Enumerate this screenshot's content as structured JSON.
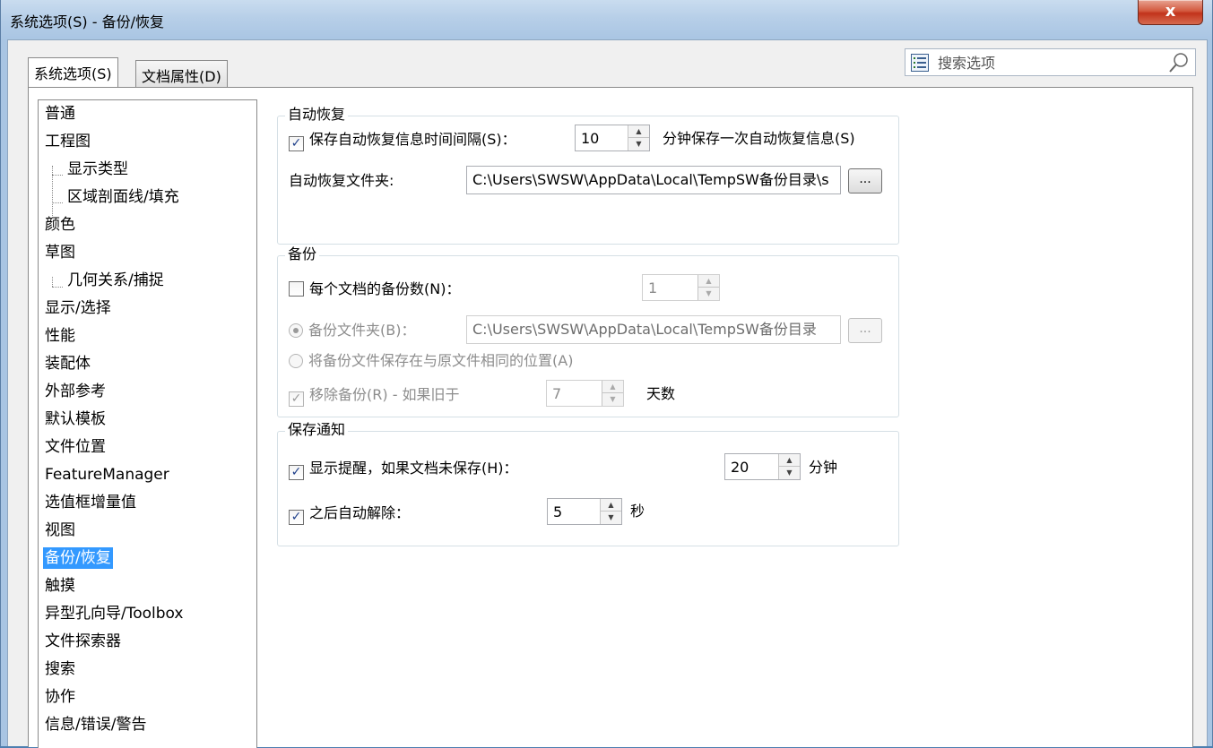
{
  "window": {
    "title": "系统选项(S) - 备份/恢复",
    "close_label": "x"
  },
  "tabs": [
    {
      "label": "系统选项(S)",
      "active": true
    },
    {
      "label": "文档属性(D)",
      "active": false
    }
  ],
  "search": {
    "placeholder": "搜索选项"
  },
  "tree": {
    "items": [
      {
        "label": "普通"
      },
      {
        "label": "工程图"
      },
      {
        "label": "显示类型"
      },
      {
        "label": "区域剖面线/填充"
      },
      {
        "label": "颜色"
      },
      {
        "label": "草图"
      },
      {
        "label": "几何关系/捕捉"
      },
      {
        "label": "显示/选择"
      },
      {
        "label": "性能"
      },
      {
        "label": "装配体"
      },
      {
        "label": "外部参考"
      },
      {
        "label": "默认模板"
      },
      {
        "label": "文件位置"
      },
      {
        "label": "FeatureManager"
      },
      {
        "label": "选值框增量值"
      },
      {
        "label": "视图"
      },
      {
        "label": "备份/恢复"
      },
      {
        "label": "触摸"
      },
      {
        "label": "异型孔向导/Toolbox"
      },
      {
        "label": "文件探索器"
      },
      {
        "label": "搜索"
      },
      {
        "label": "协作"
      },
      {
        "label": "信息/错误/警告"
      }
    ]
  },
  "autorecover": {
    "title": "自动恢复",
    "save_label": "保存自动恢复信息时间间隔(S)：",
    "save_checked": true,
    "interval": "10",
    "unit_label": "分钟保存一次自动恢复信息(S)",
    "folder_label": "自动恢复文件夹:",
    "folder_path": "C:\\Users\\SWSW\\AppData\\Local\\TempSW备份目录\\s",
    "browse": "..."
  },
  "backup": {
    "title": "备份",
    "copies_label": "每个文档的备份数(N)：",
    "copies_checked": false,
    "copies": "1",
    "folder_label": "备份文件夹(B)：",
    "folder_path": "C:\\Users\\SWSW\\AppData\\Local\\TempSW备份目录",
    "browse": "...",
    "same_location_label": "将备份文件保存在与原文件相同的位置(A)",
    "remove_label": "移除备份(R) - 如果旧于",
    "remove_checked": true,
    "remove_days": "7",
    "days_unit": "天数"
  },
  "notify": {
    "title": "保存通知",
    "remind_label": "显示提醒，如果文档未保存(H)：",
    "remind_checked": true,
    "remind_minutes": "20",
    "minutes_unit": "分钟",
    "dismiss_label": "之后自动解除：",
    "dismiss_checked": true,
    "dismiss_seconds": "5",
    "seconds_unit": "秒"
  },
  "colors": {
    "selection": "#3399ff",
    "close_button": "#c2331b",
    "titlebar": "#b7cfe8"
  },
  "icons": [
    "close-icon",
    "list-icon",
    "search-icon",
    "checkbox-check-icon",
    "spin-up-icon",
    "spin-down-icon"
  ]
}
